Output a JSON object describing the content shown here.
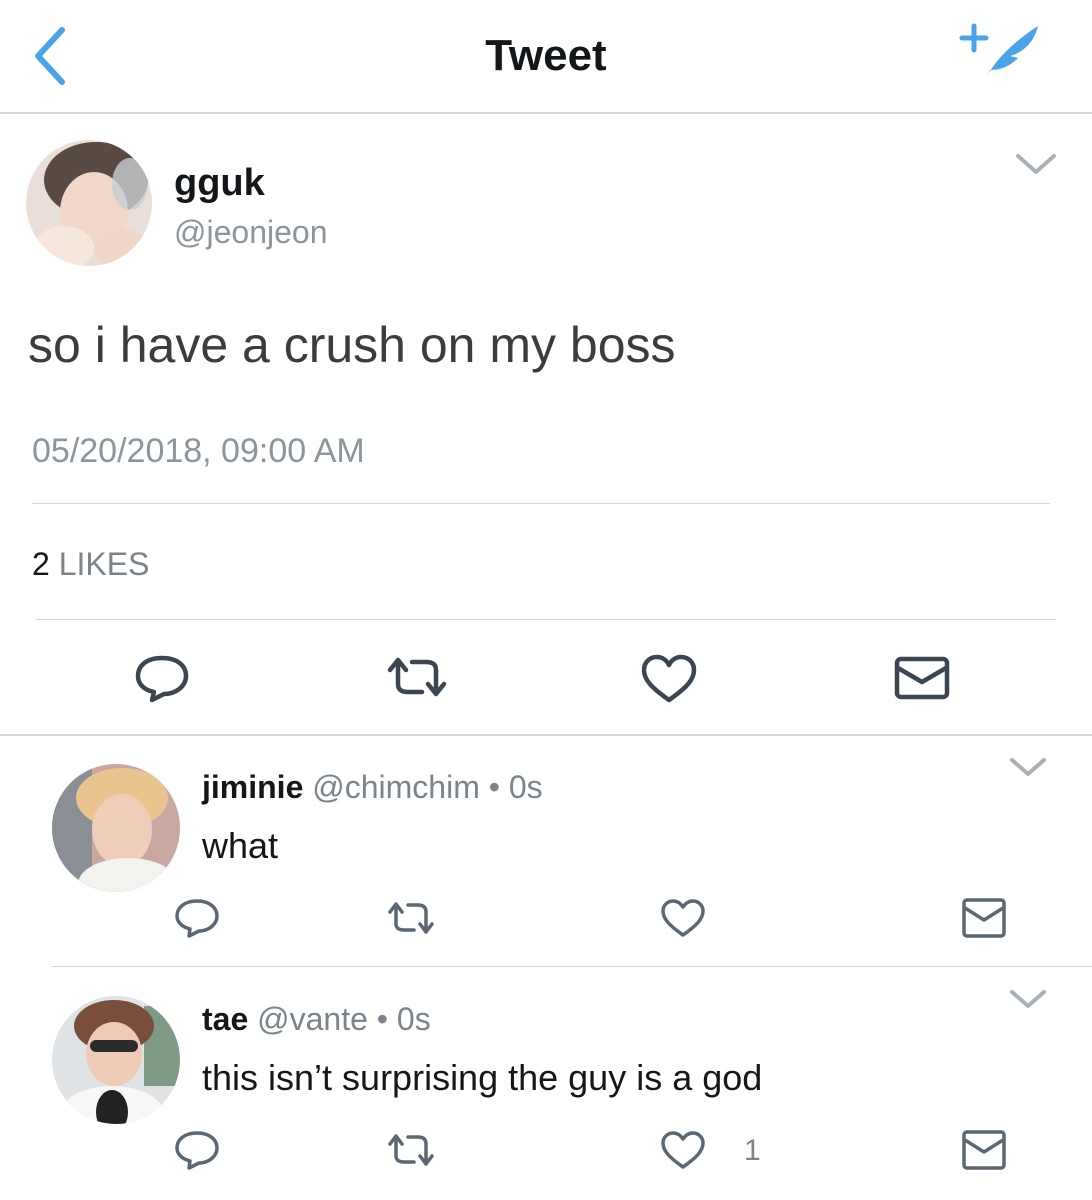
{
  "header": {
    "title": "Tweet",
    "back_icon": "chevron-left-icon",
    "compose_icon": "compose-tweet-icon",
    "accent_color": "#4aa3ea"
  },
  "main_tweet": {
    "name": "gguk",
    "handle": "@jeonjeon",
    "text": "so i have a crush on my boss",
    "timestamp": "05/20/2018, 09:00 AM",
    "likes_count": "2",
    "likes_label": "LIKES",
    "actions": [
      "reply",
      "retweet",
      "like",
      "direct-message"
    ]
  },
  "replies": [
    {
      "name": "jiminie",
      "handle": "@chimchim",
      "separator": "•",
      "time": "0s",
      "text": "what",
      "like_count": ""
    },
    {
      "name": "tae",
      "handle": "@vante",
      "separator": "•",
      "time": "0s",
      "text": "this isn’t surprising the guy is a god",
      "like_count": "1"
    }
  ],
  "colors": {
    "text": "#14171a",
    "secondary": "#8a959e",
    "divider": "#d4d8dc",
    "icon": "#6a7785",
    "main_icon": "#3b4650"
  }
}
